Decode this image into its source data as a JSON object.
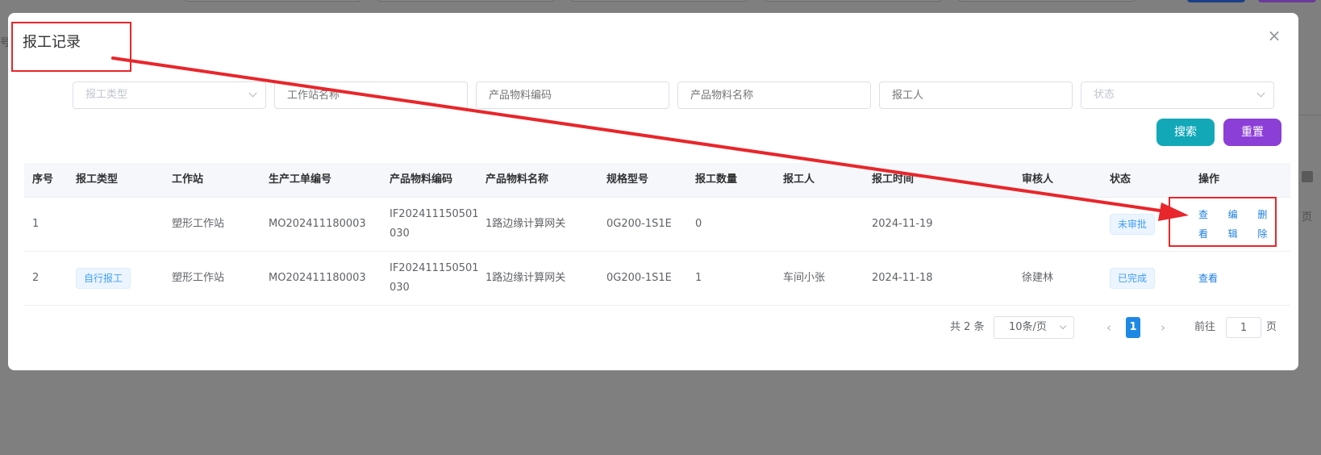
{
  "background": {
    "left_fragment": "号",
    "right_fragment": "页"
  },
  "dialog": {
    "title": "报工记录",
    "close_icon": "close-icon"
  },
  "filters": {
    "report_type": "报工类型",
    "workstation_name": "工作站名称",
    "material_code": "产品物料编码",
    "material_name": "产品物料名称",
    "reporter": "报工人",
    "status": "状态"
  },
  "buttons": {
    "search": "搜索",
    "reset": "重置"
  },
  "table": {
    "headers": [
      "序号",
      "报工类型",
      "工作站",
      "生产工单编号",
      "产品物料编码",
      "产品物料名称",
      "规格型号",
      "报工数量",
      "报工人",
      "报工时间",
      "审核人",
      "状态",
      "操作"
    ],
    "rows": [
      {
        "index": "1",
        "type": "",
        "workstation": "塑形工作站",
        "order_no": "MO202411180003",
        "material_code": "IF202411150501030",
        "material_name": "1路边缘计算网关",
        "spec": "0G200-1S1E",
        "qty": "0",
        "reporter": "",
        "time": "2024-11-19",
        "auditor": "",
        "status": "未审批",
        "actions": [
          "查看",
          "编辑",
          "删除"
        ]
      },
      {
        "index": "2",
        "type": "自行报工",
        "workstation": "塑形工作站",
        "order_no": "MO202411180003",
        "material_code": "IF202411150501030",
        "material_name": "1路边缘计算网关",
        "spec": "0G200-1S1E",
        "qty": "1",
        "reporter": "车间小张",
        "time": "2024-11-18",
        "auditor": "徐建林",
        "status": "已完成",
        "actions": [
          "查看"
        ]
      }
    ]
  },
  "pagination": {
    "total": "共 2 条",
    "page_size": "10条/页",
    "current_page": "1",
    "goto_label": "前往",
    "goto_value": "1",
    "page_unit": "页"
  },
  "colors": {
    "search_button": "#13a8b8",
    "reset_button": "#8c3fd6",
    "annotation": "#e8262b",
    "active_page": "#1e88e5",
    "link": "#1e7fe0"
  }
}
